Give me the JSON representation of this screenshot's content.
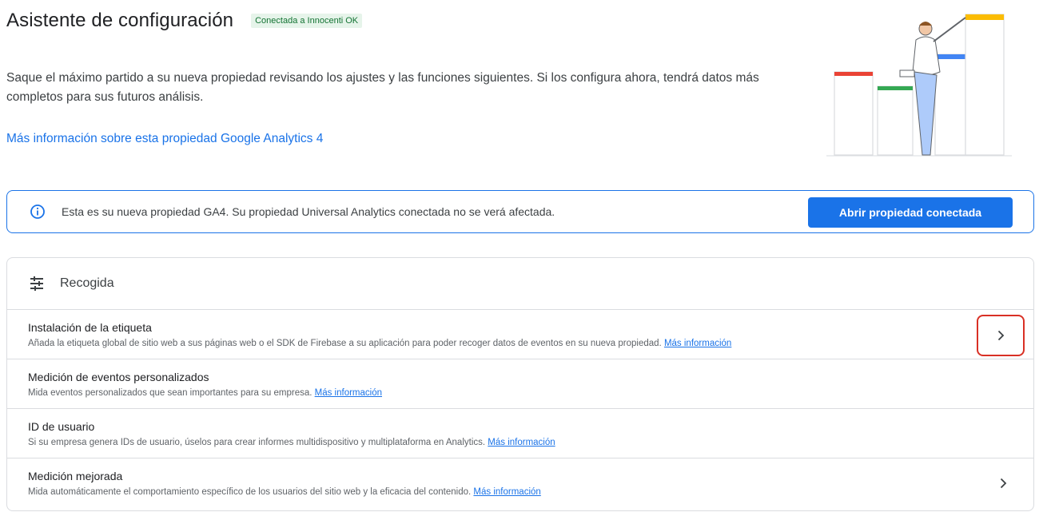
{
  "header": {
    "title": "Asistente de configuración",
    "badge": "Conectada a Innocenti OK"
  },
  "intro": {
    "text": "Saque el máximo partido a su nueva propiedad revisando los ajustes y las funciones siguientes. Si los configura ahora, tendrá datos más completos para sus futuros análisis.",
    "link": "Más información sobre esta propiedad Google Analytics 4"
  },
  "banner": {
    "icon": "info-icon",
    "text": "Esta es su nueva propiedad GA4. Su propiedad Universal Analytics conectada no se verá afectada.",
    "button": "Abrir propiedad conectada"
  },
  "collection": {
    "icon": "data-collection-icon",
    "title": "Recogida",
    "items": [
      {
        "title": "Instalación de la etiqueta",
        "desc": "Añada la etiqueta global de sitio web a sus páginas web o el SDK de Firebase a su aplicación para poder recoger datos de eventos en su nueva propiedad.",
        "link": "Más información"
      },
      {
        "title": "Medición de eventos personalizados",
        "desc": "Mida eventos personalizados que sean importantes para su empresa.",
        "link": "Más información"
      },
      {
        "title": "ID de usuario",
        "desc": "Si su empresa genera IDs de usuario, úselos para crear informes multidispositivo y multiplataforma en Analytics.",
        "link": "Más información"
      },
      {
        "title": "Medición mejorada",
        "desc": "Mida automáticamente el comportamiento específico de los usuarios del sitio web y la eficacia del contenido.",
        "link": "Más información"
      }
    ]
  },
  "colors": {
    "accent": "#1a73e8",
    "highlight": "#d93025",
    "badge_bg": "#e6f4ea",
    "badge_text": "#137333"
  }
}
